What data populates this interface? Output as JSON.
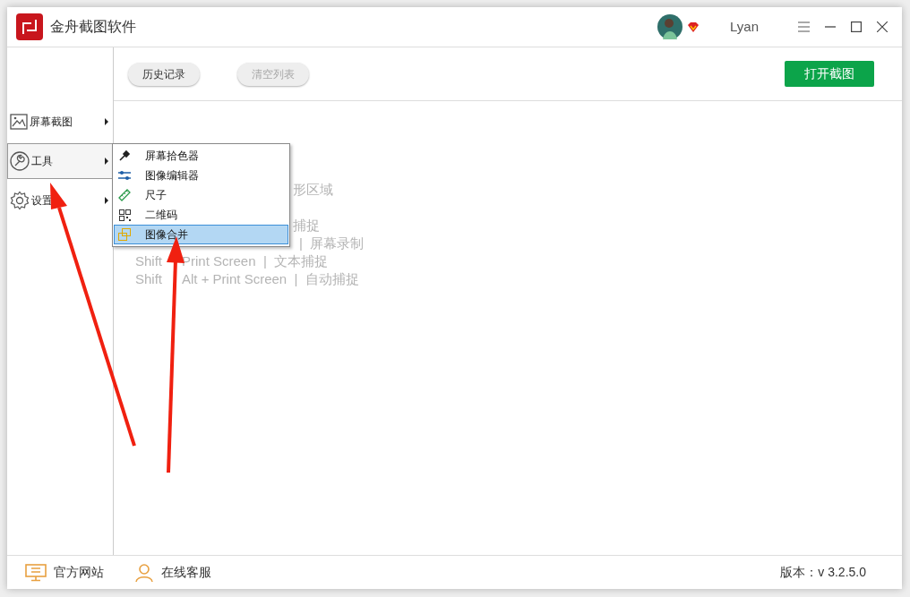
{
  "window": {
    "title": "金舟截图软件",
    "user": "Lyan"
  },
  "toolbar": {
    "buttons": [
      {
        "label": "历史记录",
        "disabled": false
      },
      {
        "label": "清空列表",
        "disabled": true
      }
    ],
    "primary": "打开截图"
  },
  "sidebar": {
    "items": [
      {
        "label": "屏幕截图",
        "selected": false
      },
      {
        "label": "工具",
        "selected": true
      },
      {
        "label": "设置",
        "selected": false
      }
    ]
  },
  "menu": {
    "items": [
      {
        "label": "屏幕拾色器",
        "selected": false
      },
      {
        "label": "图像编辑器",
        "selected": false
      },
      {
        "label": "尺子",
        "selected": false
      },
      {
        "label": "二维码",
        "selected": false
      },
      {
        "label": "图像合并",
        "selected": true
      }
    ]
  },
  "hints": [
    {
      "parts": [
        "形区域"
      ]
    },
    {
      "parts": [
        "捕捉"
      ]
    },
    {
      "parts": [
        "|  屏幕录制"
      ]
    },
    {
      "parts": [
        "Shift",
        "Print Screen  |  文本捕捉"
      ]
    },
    {
      "parts": [
        "Shift",
        "Alt + Print Screen  |  自动捕捉"
      ]
    }
  ],
  "footer": {
    "links": [
      {
        "label": "官方网站"
      },
      {
        "label": "在线客服"
      }
    ],
    "version": "版本：v 3.2.5.0"
  }
}
